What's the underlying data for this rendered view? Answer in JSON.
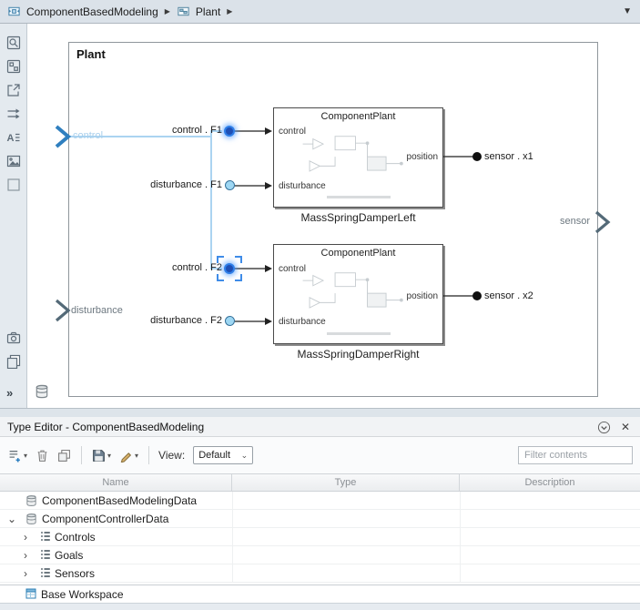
{
  "breadcrumb": {
    "model": "ComponentBasedModeling",
    "subsystem": "Plant"
  },
  "icons": {
    "sep": "▶",
    "overflow_caret": "▼",
    "caret_down": "▾",
    "select_caret": "⌄",
    "rail_expand": "»",
    "close": "✕",
    "chevron_expanded": "⌄",
    "chevron_collapsed": "›"
  },
  "canvas": {
    "title": "Plant",
    "ports": {
      "in1": "control",
      "in2": "disturbance",
      "out1": "sensor"
    },
    "labels": {
      "control_f1": "control . F1",
      "disturbance_f1": "disturbance . F1",
      "control_f2": "control . F2",
      "disturbance_f2": "disturbance . F2",
      "sensor_x1": "sensor . x1",
      "sensor_x2": "sensor . x2"
    },
    "blocks": [
      {
        "title": "ComponentPlant",
        "in1": "control",
        "in2": "disturbance",
        "out": "position",
        "caption": "MassSpringDamperLeft"
      },
      {
        "title": "ComponentPlant",
        "in1": "control",
        "in2": "disturbance",
        "out": "position",
        "caption": "MassSpringDamperRight"
      }
    ]
  },
  "type_editor": {
    "title": "Type Editor - ComponentBasedModeling",
    "toolbar": {
      "view_label": "View:",
      "view_value": "Default",
      "filter_placeholder": "Filter contents"
    },
    "table": {
      "columns": [
        "Name",
        "Type",
        "Description"
      ],
      "rows": [
        {
          "name": "ComponentBasedModelingData",
          "type": "",
          "description": ""
        },
        {
          "name": "ComponentControllerData",
          "type": "",
          "description": ""
        },
        {
          "name": "Controls",
          "type": "",
          "description": ""
        },
        {
          "name": "Goals",
          "type": "",
          "description": ""
        },
        {
          "name": "Sensors",
          "type": "",
          "description": ""
        },
        {
          "name": "Base Workspace",
          "type": "",
          "description": ""
        }
      ]
    }
  },
  "colors": {
    "selection_blue": "#3f8ce8",
    "port_highlight": "#1e4fb5",
    "port_light": "#9ed7f3",
    "trace_blue": "#abd4f1",
    "topbar_bg": "#dbe2e9"
  }
}
